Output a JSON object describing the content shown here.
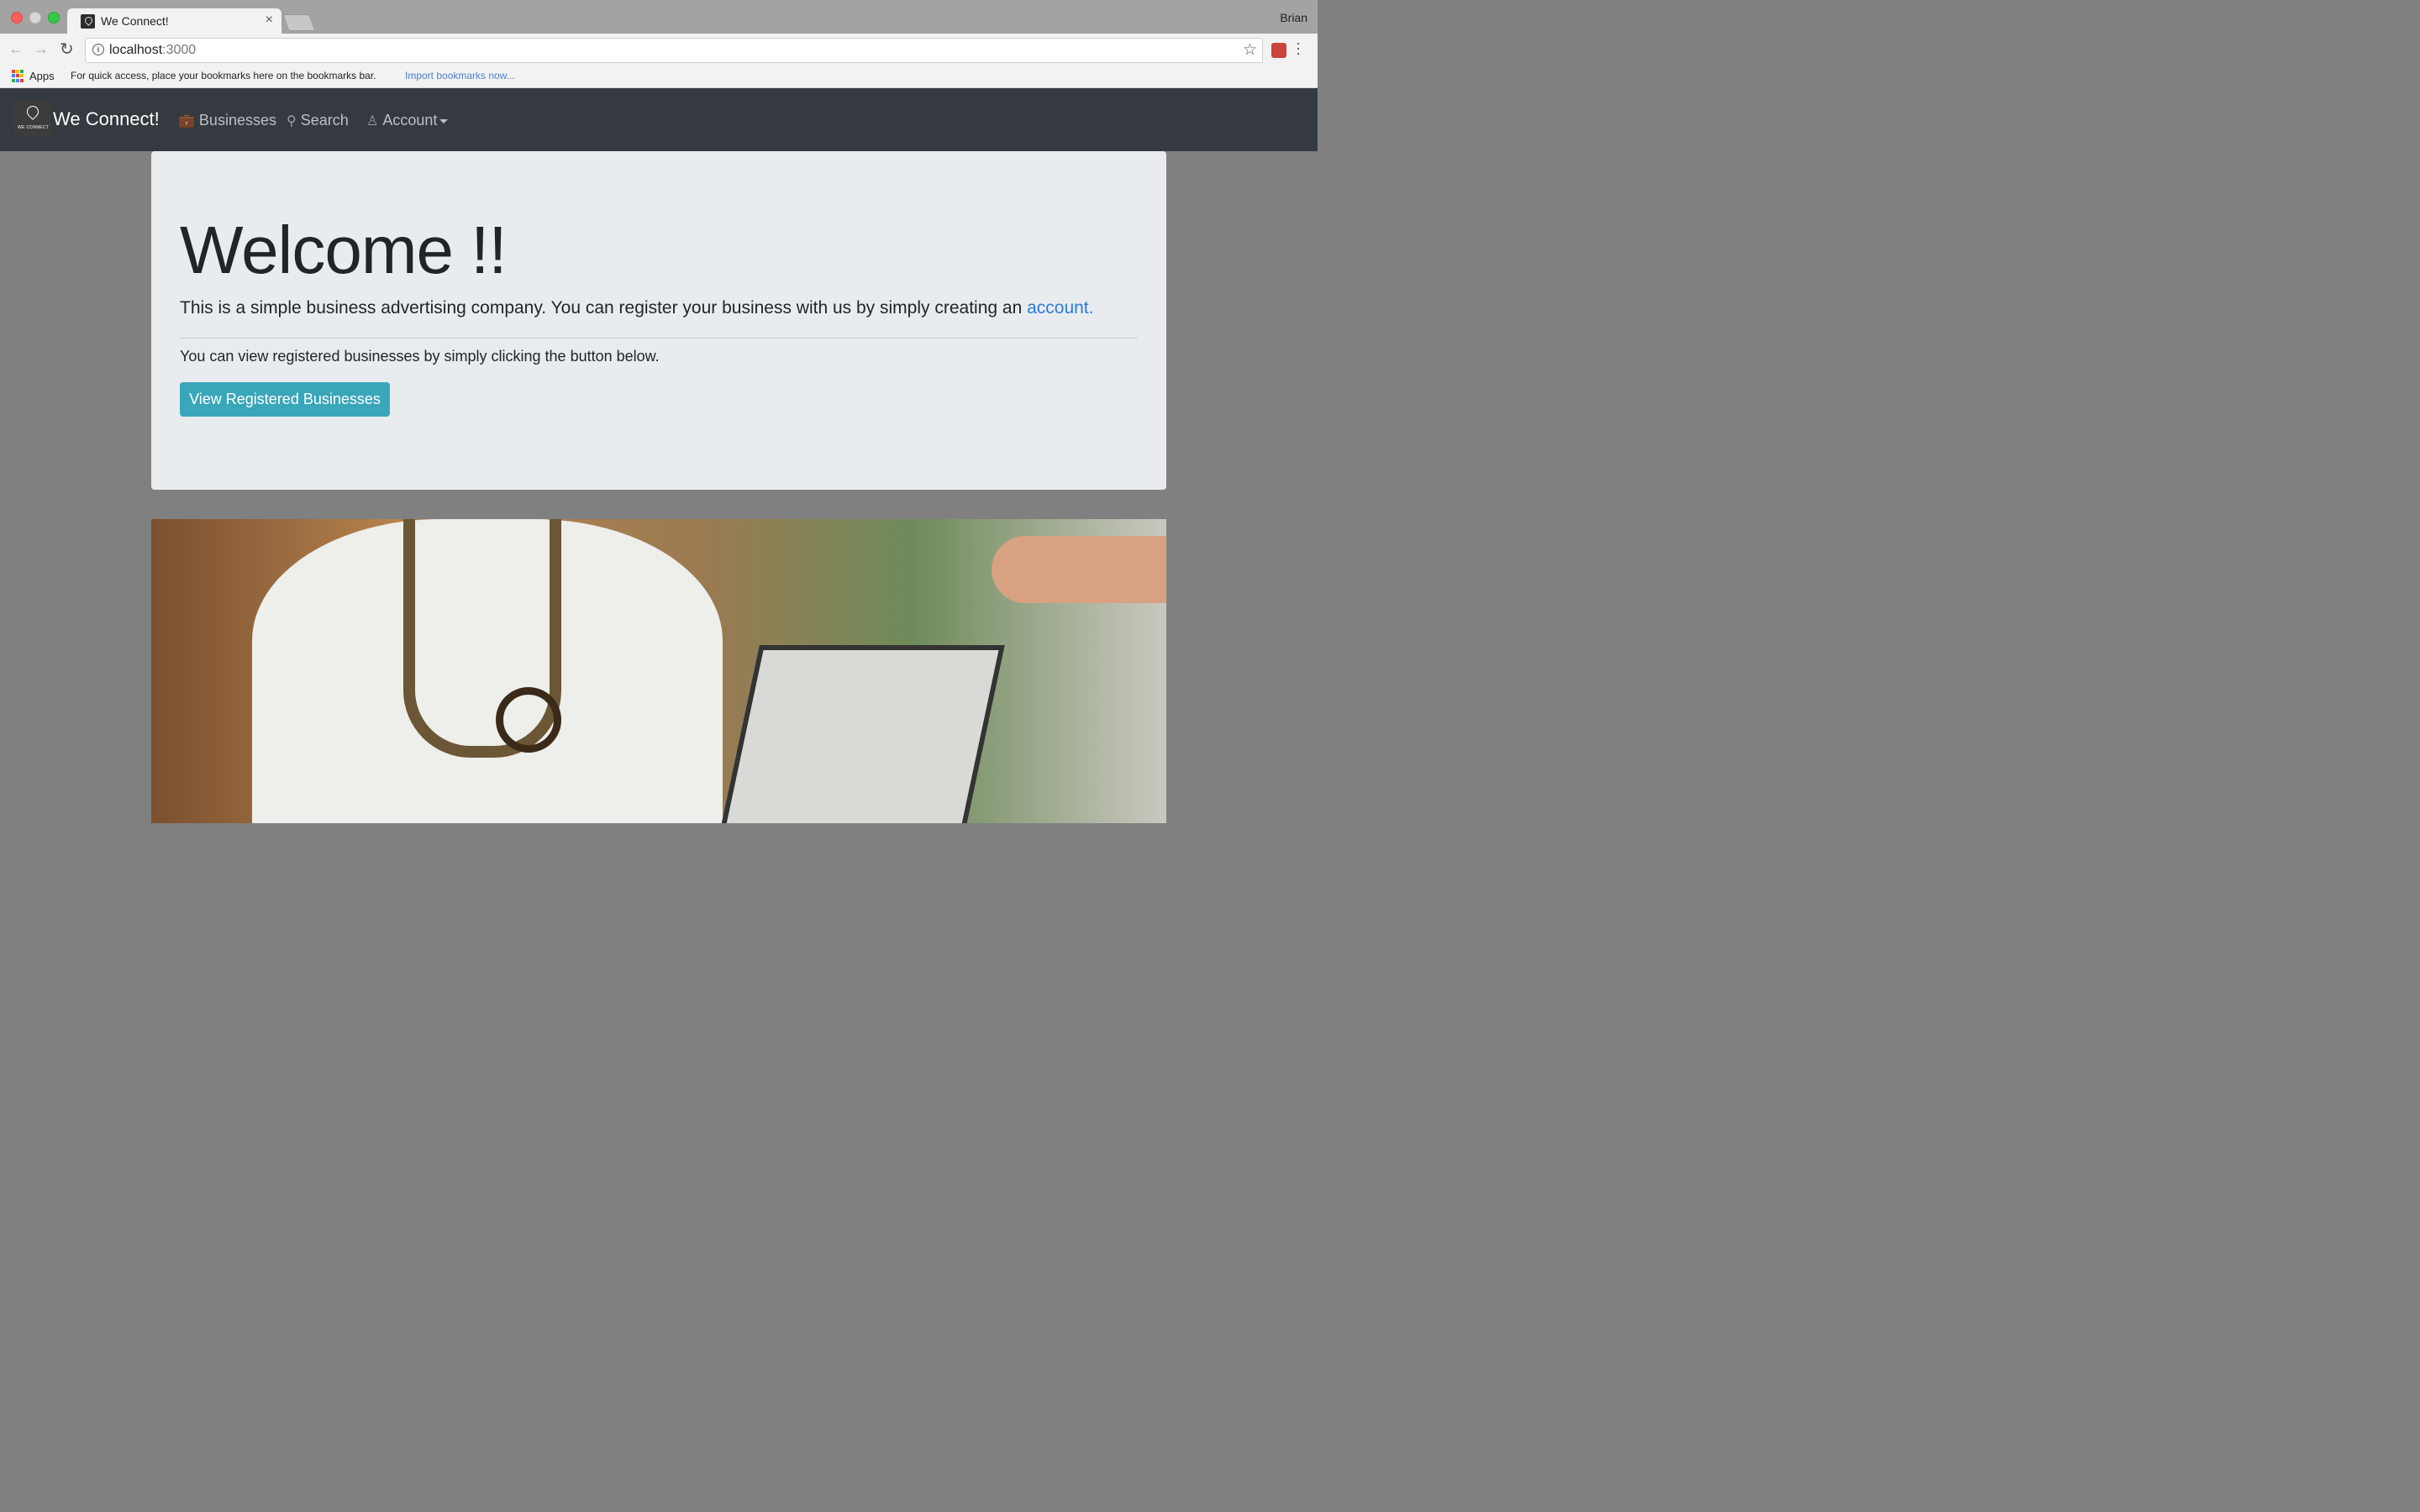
{
  "browser": {
    "tab_title": "We Connect!",
    "tab_close": "×",
    "profile_name": "Brian",
    "url_host": "localhost",
    "url_port": ":3000",
    "star_icon": "☆",
    "bookmarks_bar": {
      "apps_label": "Apps",
      "hint": "For quick access, place your bookmarks here on the bookmarks bar.",
      "import_link": "Import bookmarks now..."
    }
  },
  "navbar": {
    "brand": "We Connect!",
    "items": [
      {
        "label": "Businesses",
        "icon": "briefcase-icon"
      },
      {
        "label": "Search",
        "icon": "search-icon"
      },
      {
        "label": "Account",
        "icon": "user-icon"
      }
    ]
  },
  "hero": {
    "title": "Welcome !!",
    "lead_text": "This is a simple business advertising company. You can register your business with us by simply creating an ",
    "lead_link": "account.",
    "subtext": "You can view registered businesses by simply clicking the button below.",
    "button_label": "View Registered Businesses"
  },
  "colors": {
    "navbar_bg": "#343a40",
    "jumbotron_bg": "#e9ecef",
    "button_bg": "#3aa6b9",
    "link": "#2b7bdc",
    "page_bg": "#808080"
  }
}
